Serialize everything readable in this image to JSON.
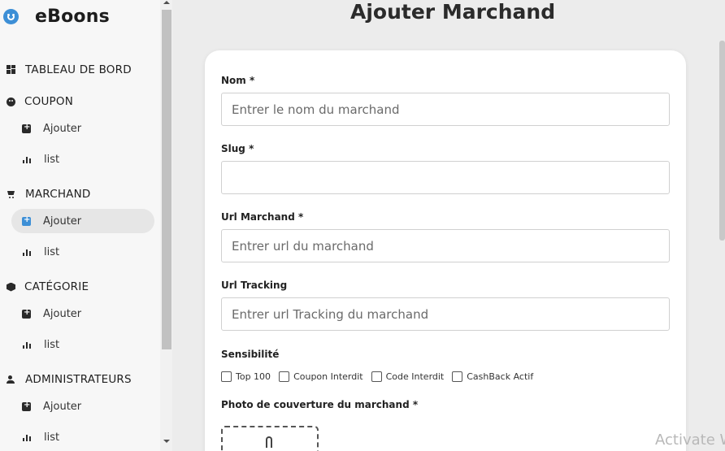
{
  "brand": {
    "name": "eBoons",
    "icon": "smiley-icon"
  },
  "nav": [
    {
      "type": "section",
      "label": "TABLEAU DE BORD",
      "icon": "dashboard-icon"
    },
    {
      "type": "section",
      "label": "COUPON",
      "icon": "coupon-icon"
    },
    {
      "type": "sub",
      "label": "Ajouter",
      "icon": "add-box-icon"
    },
    {
      "type": "sub",
      "label": "list",
      "icon": "bar-chart-icon"
    },
    {
      "type": "section",
      "label": "MARCHAND",
      "icon": "cart-icon"
    },
    {
      "type": "sub",
      "label": "Ajouter",
      "icon": "add-box-icon",
      "active": true
    },
    {
      "type": "sub",
      "label": "list",
      "icon": "bar-chart-icon"
    },
    {
      "type": "section",
      "label": "CATÉGORIE",
      "icon": "box-icon"
    },
    {
      "type": "sub",
      "label": "Ajouter",
      "icon": "add-box-icon"
    },
    {
      "type": "sub",
      "label": "list",
      "icon": "bar-chart-icon"
    },
    {
      "type": "section",
      "label": "ADMINISTRATEURS",
      "icon": "users-icon"
    },
    {
      "type": "sub",
      "label": "Ajouter",
      "icon": "add-box-icon"
    },
    {
      "type": "sub",
      "label": "list",
      "icon": "bar-chart-icon"
    }
  ],
  "page": {
    "title": "Ajouter Marchand"
  },
  "form": {
    "nom": {
      "label": "Nom *",
      "placeholder": "Entrer le nom du marchand",
      "value": ""
    },
    "slug": {
      "label": "Slug *",
      "placeholder": "",
      "value": ""
    },
    "url_marchand": {
      "label": "Url Marchand *",
      "placeholder": "Entrer url du marchand",
      "value": ""
    },
    "url_tracking": {
      "label": "Url Tracking",
      "placeholder": "Entrer url Tracking du marchand",
      "value": ""
    },
    "sensibilite": {
      "label": "Sensibilité",
      "options": [
        {
          "label": "Top 100",
          "checked": false
        },
        {
          "label": "Coupon Interdit",
          "checked": false
        },
        {
          "label": "Code Interdit",
          "checked": false
        },
        {
          "label": "CashBack Actif",
          "checked": false
        }
      ]
    },
    "photo": {
      "label": "Photo de couverture du marchand *",
      "icon": "paperclip-icon"
    }
  },
  "watermark": "Activate W",
  "colors": {
    "accent": "#3d8fd6",
    "background": "#ececec",
    "sidebar": "#f7f7f7",
    "card": "#ffffff"
  }
}
